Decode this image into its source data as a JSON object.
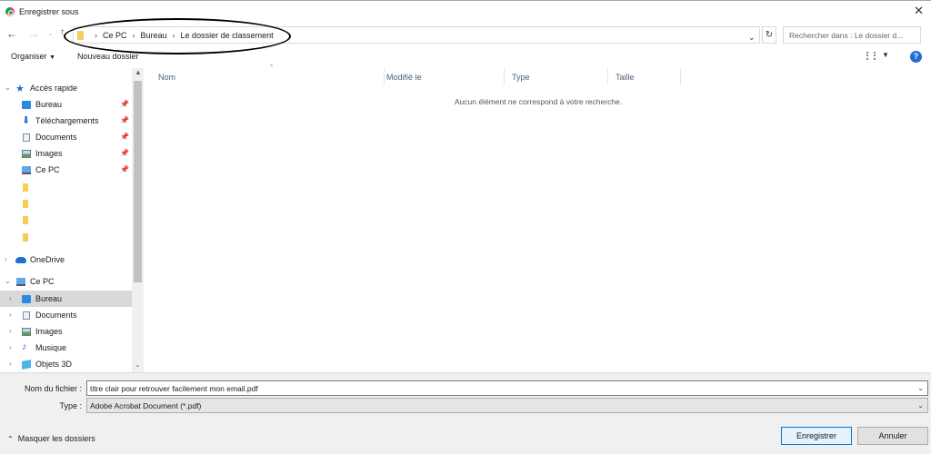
{
  "window": {
    "title": "Enregistrer sous",
    "close_glyph": "✕"
  },
  "address": {
    "breadcrumbs": [
      "Ce PC",
      "Bureau",
      "Le dossier de classement"
    ],
    "search_placeholder": "Rechercher dans : Le dossier d..."
  },
  "toolbar": {
    "organize": "Organiser",
    "new_folder": "Nouveau dossier",
    "help": "?"
  },
  "sidebar": {
    "quick_access": "Accès rapide",
    "quick_items": [
      "Bureau",
      "Téléchargements",
      "Documents",
      "Images",
      "Ce PC"
    ],
    "onedrive": "OneDrive",
    "this_pc": "Ce PC",
    "pc_items": [
      "Bureau",
      "Documents",
      "Images",
      "Musique",
      "Objets 3D"
    ],
    "selected": "Bureau"
  },
  "columns": [
    "Nom",
    "Modifié le",
    "Type",
    "Taille"
  ],
  "empty_message": "Aucun élément ne correspond à votre recherche.",
  "filename": {
    "label": "Nom du fichier :",
    "value": "titre clair pour retrouver facilement mon email.pdf"
  },
  "filetype": {
    "label": "Type :",
    "value": "Adobe Acrobat Document (*.pdf)"
  },
  "hide_folders": "Masquer les dossiers",
  "buttons": {
    "save": "Enregistrer",
    "cancel": "Annuler"
  },
  "colors": {
    "accent": "#0078d7",
    "folder": "#f6cd57",
    "star": "#1e6fd0"
  }
}
